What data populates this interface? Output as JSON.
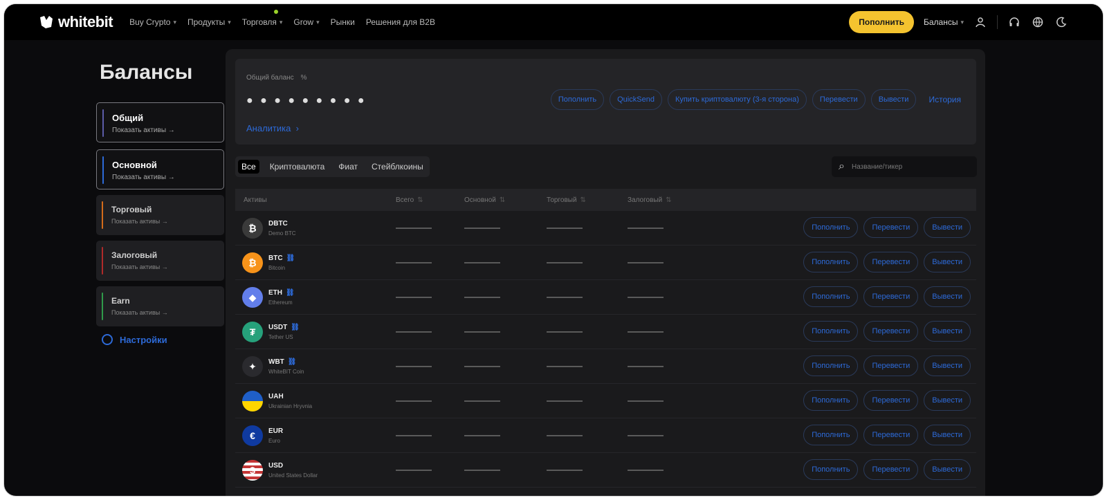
{
  "header": {
    "logo_text": "whitebit",
    "nav": [
      {
        "label": "Buy Crypto",
        "chevron": true
      },
      {
        "label": "Продукты",
        "chevron": true
      },
      {
        "label": "Торговля",
        "chevron": true,
        "dot": true
      },
      {
        "label": "Grow",
        "chevron": true
      },
      {
        "label": "Рынки",
        "chevron": false
      },
      {
        "label": "Решения для B2B",
        "chevron": false
      }
    ],
    "deposit_button": "Пополнить",
    "balances_menu": "Балансы",
    "icons": [
      "user-icon",
      "headset-icon",
      "globe-icon",
      "moon-icon"
    ]
  },
  "sidebar": {
    "title": "Балансы",
    "accounts": [
      {
        "name": "Общий",
        "sub": "Показать активы",
        "accent": "#5c5ca8",
        "active": true
      },
      {
        "name": "Основной",
        "sub": "Показать активы",
        "accent": "#2d6ad8",
        "active": true
      },
      {
        "name": "Торговый",
        "sub": "Показать активы",
        "accent": "#d46b1a",
        "active": false
      },
      {
        "name": "Залоговый",
        "sub": "Показать активы",
        "accent": "#b02a2a",
        "active": false
      },
      {
        "name": "Earn",
        "sub": "Показать активы",
        "accent": "#2f9a4a",
        "active": false
      }
    ],
    "settings": "Настройки"
  },
  "summary": {
    "label": "Общий баланс",
    "currency_suffix": "%",
    "masked_value": "● ● ● ● ● ● ● ● ●",
    "analytics_link": "Аналитика",
    "actions": [
      "Пополнить",
      "QuickSend",
      "Купить криптовалюту (3-я сторона)",
      "Перевести",
      "Вывести"
    ],
    "history_link": "История"
  },
  "filters": {
    "tabs": [
      "Все",
      "Криптовалюта",
      "Фиат",
      "Стейблкоины"
    ],
    "active_tab": "Все",
    "search_placeholder": "Название/тикер"
  },
  "table": {
    "columns": [
      "Активы",
      "Всего",
      "Основной",
      "Торговый",
      "Залоговый"
    ],
    "row_actions": [
      "Пополнить",
      "Перевести",
      "Вывести"
    ],
    "rows": [
      {
        "ticker": "DBTC",
        "name": "Demo BTC",
        "color": "#3a3a3a",
        "glyph": "₿",
        "chain": false
      },
      {
        "ticker": "BTC",
        "name": "Bitcoin",
        "color": "#f7931a",
        "glyph": "₿",
        "chain": true
      },
      {
        "ticker": "ETH",
        "name": "Ethereum",
        "color": "#627eea",
        "glyph": "◆",
        "chain": true
      },
      {
        "ticker": "USDT",
        "name": "Tether US",
        "color": "#26a17b",
        "glyph": "₮",
        "chain": true
      },
      {
        "ticker": "WBT",
        "name": "WhiteBIT Coin",
        "color": "#2a2a2e",
        "glyph": "✦",
        "chain": true
      },
      {
        "ticker": "UAH",
        "name": "Ukrainian Hryvnia",
        "color": "#ffd500",
        "glyph": "",
        "chain": false
      },
      {
        "ticker": "EUR",
        "name": "Euro",
        "color": "#0f3aa0",
        "glyph": "€",
        "chain": false
      },
      {
        "ticker": "USD",
        "name": "United States Dollar",
        "color": "#c53636",
        "glyph": "$",
        "chain": false
      }
    ]
  }
}
